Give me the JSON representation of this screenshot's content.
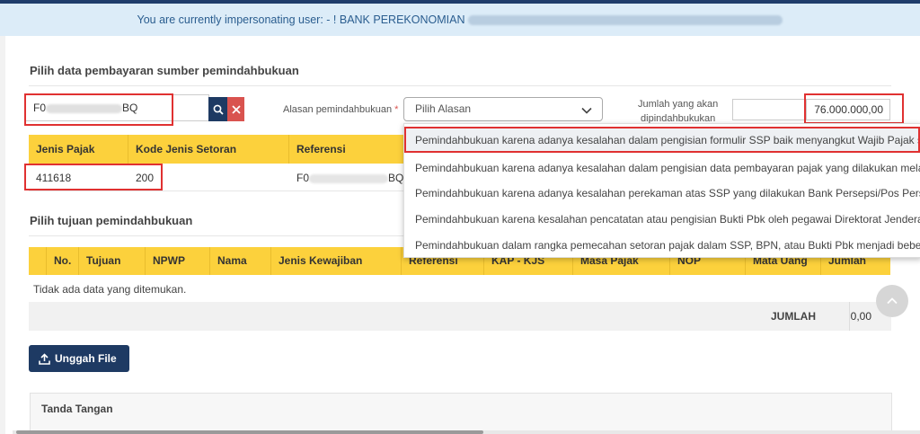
{
  "banner": {
    "text": "You are currently impersonating user: - ! BANK PEREKONOMIAN"
  },
  "source": {
    "title": "Pilih data pembayaran sumber pemindahbukuan",
    "input_prefix": "F0",
    "input_suffix": "BQ",
    "search_icon": "search-icon",
    "clear_icon": "close-icon"
  },
  "alasan": {
    "label": "Alasan pemindahbukuan",
    "required_mark": "*",
    "selected": "Pilih Alasan",
    "options": [
      "Pemindahbukuan karena adanya kesalahan dalam pengisian formulir SSP baik menyangkut Wajib Pajak send",
      "Pemindahbukuan karena adanya kesalahan dalam pengisian data pembayaran pajak yang dilakukan melalui s",
      "Pemindahbukuan karena adanya kesalahan perekaman atas SSP yang dilakukan Bank Persepsi/Pos Persepsi/B",
      "Pemindahbukuan karena kesalahan pencatatan atau pengisian Bukti Pbk oleh pegawai Direktorat Jenderal Pa",
      "Pemindahbukuan dalam rangka pemecahan setoran pajak dalam SSP, BPN, atau Bukti Pbk menjadi beberapa"
    ]
  },
  "jumlah": {
    "label_line1": "Jumlah yang akan",
    "label_line2": "dipindahbukukan",
    "value": "76.000.000,00"
  },
  "source_table": {
    "headers": [
      "Jenis Pajak",
      "Kode Jenis Setoran",
      "Referensi"
    ],
    "row": {
      "jenis_pajak": "411618",
      "kode_jenis_setoran": "200",
      "referensi_prefix": "F0",
      "referensi_suffix": "BQ"
    }
  },
  "target": {
    "title": "Pilih tujuan pemindahbukuan",
    "headers": [
      "No.",
      "Tujuan",
      "NPWP",
      "Nama",
      "Jenis Kewajiban",
      "Referensi",
      "KAP - KJS",
      "Masa Pajak",
      "NOP",
      "Mata Uang",
      "Jumlah"
    ],
    "empty_text": "Tidak ada data yang ditemukan.",
    "total_label": "JUMLAH",
    "total_value": "0,00"
  },
  "upload": {
    "label": "Unggah File",
    "icon": "upload-icon"
  },
  "signature": {
    "label": "Tanda Tangan"
  },
  "colors": {
    "header_yellow": "#fcd13c",
    "primary_navy": "#1e3a63",
    "danger": "#d9534f",
    "highlight_red": "#e03131"
  }
}
